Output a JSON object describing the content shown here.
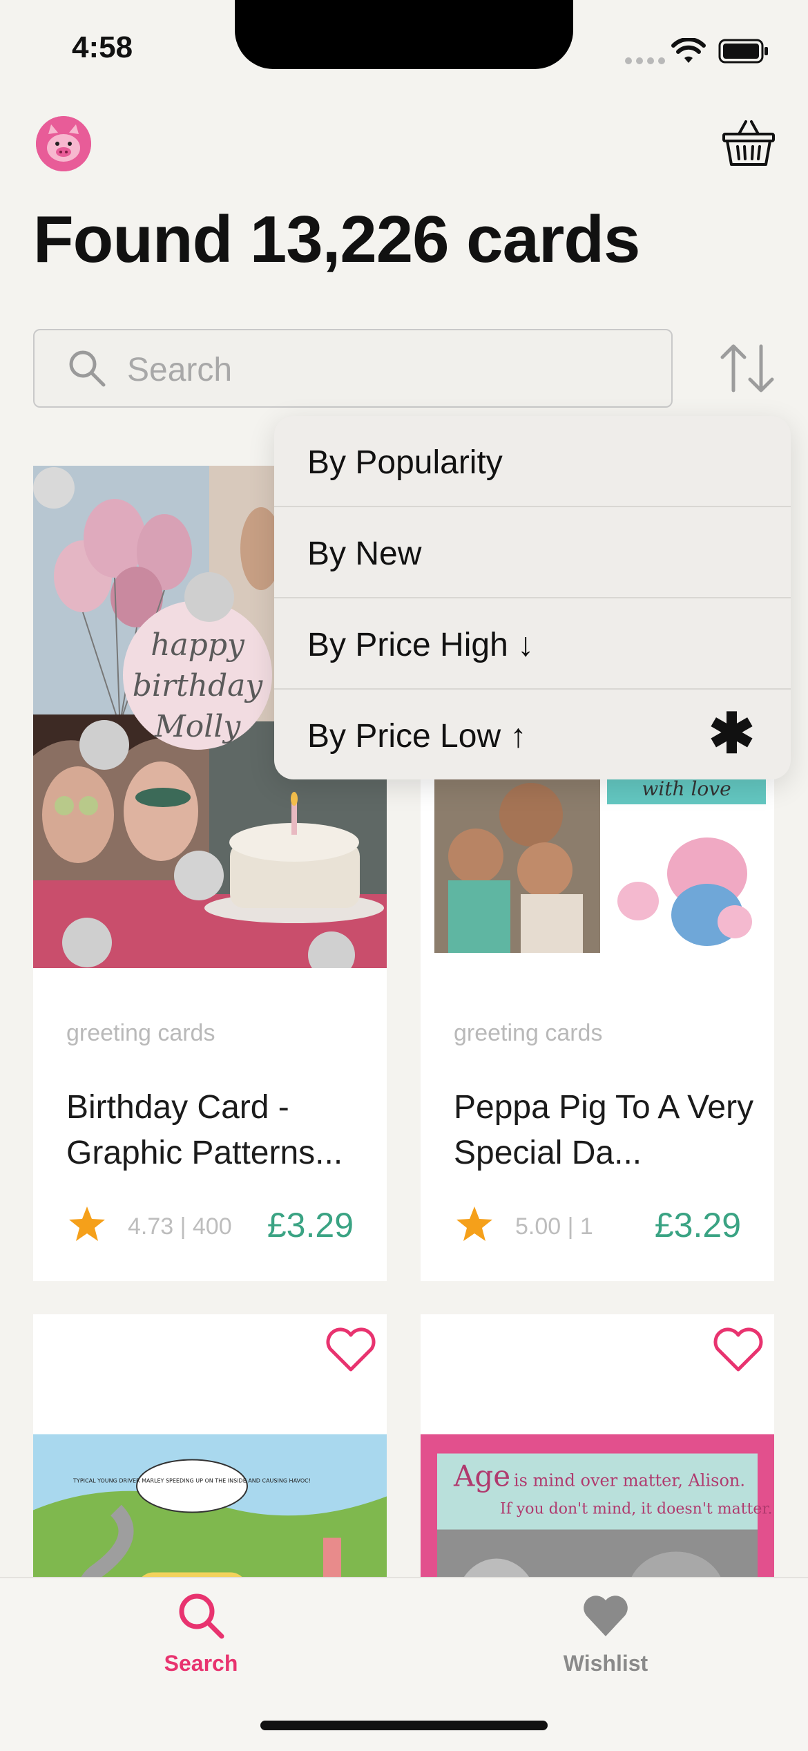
{
  "status_bar": {
    "time": "4:58"
  },
  "header": {
    "title": "Found 13,226 cards"
  },
  "search": {
    "placeholder": "Search"
  },
  "sort_menu": {
    "options": [
      "By Popularity",
      "By New",
      "By Price High ↓",
      "By Price Low ↑"
    ],
    "selected_mark": "✱"
  },
  "cards": [
    {
      "category": "greeting cards",
      "title": "Birthday Card - Graphic Patterns...",
      "rating": "4.73 | 400",
      "price": "£3.29",
      "image_text": [
        "happy",
        "birthday",
        "Molly"
      ]
    },
    {
      "category": "greeting cards",
      "title": "Peppa Pig To A Very Special Da...",
      "rating": "5.00 | 1",
      "price": "£3.29",
      "image_text": [
        "with love"
      ]
    },
    {
      "image_text": [
        "TYPICAL YOUNG DRIVER MARLEY SPEEDING UP ON THE INSIDE AND CAUSING HAVOC!"
      ]
    },
    {
      "image_text": [
        "Age",
        "is mind over matter, Alison.",
        "If you don't mind, it doesn't matter."
      ]
    }
  ],
  "tabs": [
    {
      "label": "Search",
      "active": true
    },
    {
      "label": "Wishlist",
      "active": false
    }
  ],
  "colors": {
    "accent": "#e8336f",
    "price": "#3aa383",
    "star": "#f5a01a",
    "inactive": "#8a8a8a"
  }
}
